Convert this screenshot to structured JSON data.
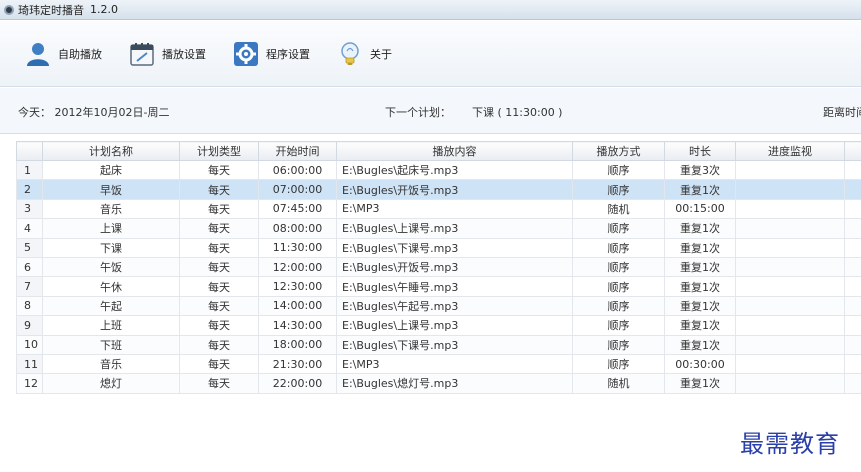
{
  "titlebar": {
    "title": "琦玮定时播音",
    "version": "1.2.0"
  },
  "toolbar": {
    "items": [
      {
        "label": "自助播放",
        "icon": "user-icon"
      },
      {
        "label": "播放设置",
        "icon": "calendar-icon"
      },
      {
        "label": "程序设置",
        "icon": "settings-icon"
      },
      {
        "label": "关于",
        "icon": "lightbulb-icon"
      }
    ]
  },
  "status": {
    "today": "今天： 2012年10月02日-周二",
    "next_label": "下一个计划：",
    "next_value": "下课 ( 11:30:00 )",
    "distance": "距离时间"
  },
  "table": {
    "headers": [
      "",
      "计划名称",
      "计划类型",
      "开始时间",
      "播放内容",
      "播放方式",
      "时长",
      "进度监视",
      ""
    ],
    "rows": [
      [
        "1",
        "起床",
        "每天",
        "06:00:00",
        "E:\\Bugles\\起床号.mp3",
        "顺序",
        "重复3次",
        "",
        ""
      ],
      [
        "2",
        "早饭",
        "每天",
        "07:00:00",
        "E:\\Bugles\\开饭号.mp3",
        "顺序",
        "重复1次",
        "",
        ""
      ],
      [
        "3",
        "音乐",
        "每天",
        "07:45:00",
        "E:\\MP3",
        "随机",
        "00:15:00",
        "",
        ""
      ],
      [
        "4",
        "上课",
        "每天",
        "08:00:00",
        "E:\\Bugles\\上课号.mp3",
        "顺序",
        "重复1次",
        "",
        ""
      ],
      [
        "5",
        "下课",
        "每天",
        "11:30:00",
        "E:\\Bugles\\下课号.mp3",
        "顺序",
        "重复1次",
        "",
        ""
      ],
      [
        "6",
        "午饭",
        "每天",
        "12:00:00",
        "E:\\Bugles\\开饭号.mp3",
        "顺序",
        "重复1次",
        "",
        ""
      ],
      [
        "7",
        "午休",
        "每天",
        "12:30:00",
        "E:\\Bugles\\午睡号.mp3",
        "顺序",
        "重复1次",
        "",
        ""
      ],
      [
        "8",
        "午起",
        "每天",
        "14:00:00",
        "E:\\Bugles\\午起号.mp3",
        "顺序",
        "重复1次",
        "",
        ""
      ],
      [
        "9",
        "上班",
        "每天",
        "14:30:00",
        "E:\\Bugles\\上课号.mp3",
        "顺序",
        "重复1次",
        "",
        ""
      ],
      [
        "10",
        "下班",
        "每天",
        "18:00:00",
        "E:\\Bugles\\下课号.mp3",
        "顺序",
        "重复1次",
        "",
        ""
      ],
      [
        "11",
        "音乐",
        "每天",
        "21:30:00",
        "E:\\MP3",
        "顺序",
        "00:30:00",
        "",
        ""
      ],
      [
        "12",
        "熄灯",
        "每天",
        "22:00:00",
        "E:\\Bugles\\熄灯号.mp3",
        "随机",
        "重复1次",
        "",
        ""
      ]
    ],
    "selected_row": 2
  },
  "watermark": "最需教育",
  "colors": {
    "selected_row": "#cfe3f7",
    "watermark": "#2b3fa8"
  }
}
